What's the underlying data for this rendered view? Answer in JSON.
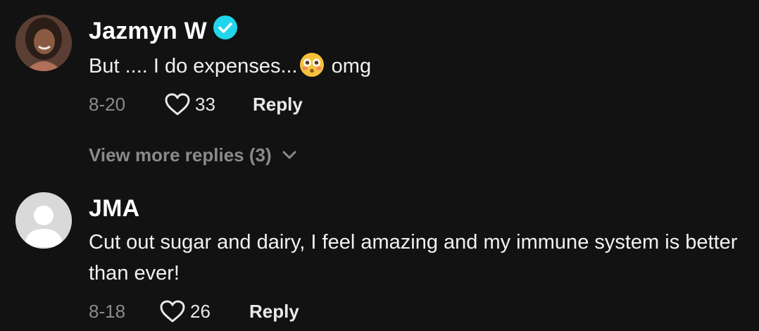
{
  "comments": [
    {
      "username": "Jazmyn W",
      "verified": true,
      "avatar_icon": "user-photo-avatar",
      "text_before": "But .... I do expenses...",
      "emoji": "flushed-face",
      "text_after": " omg",
      "date": "8-20",
      "likes": "33",
      "reply_label": "Reply",
      "view_more": "View more replies (3)"
    },
    {
      "username": "JMA",
      "verified": false,
      "avatar_icon": "default-user-avatar",
      "text": "Cut out sugar and dairy, I feel amazing and my immune system is better than ever!",
      "date": "8-18",
      "likes": "26",
      "reply_label": "Reply"
    }
  ],
  "colors": {
    "background": "#121212",
    "verified_badge": "#20d5ec",
    "muted_text": "#8a8a8a"
  }
}
